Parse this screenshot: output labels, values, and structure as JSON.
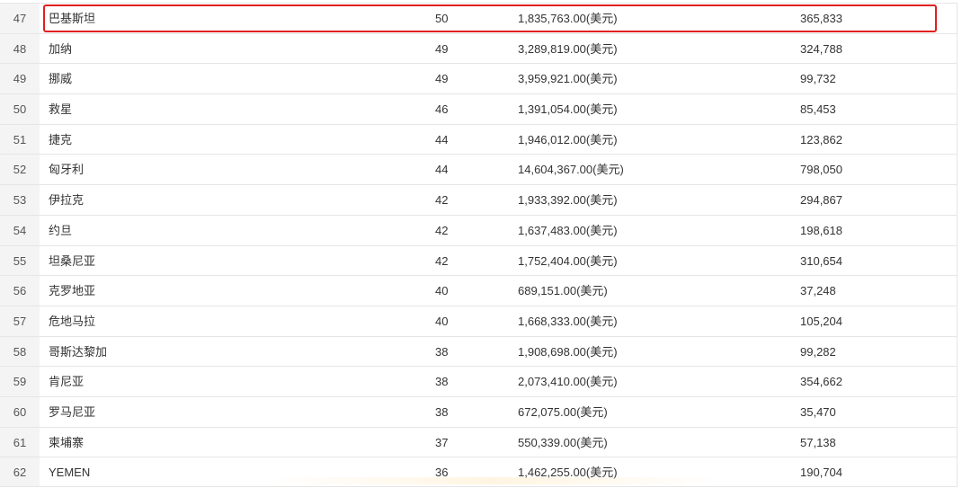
{
  "table": {
    "rows": [
      {
        "idx": "47",
        "country": "巴基斯坦",
        "count": "50",
        "amount": "1,835,763.00(美元)",
        "people": "365,833",
        "highlighted": true
      },
      {
        "idx": "48",
        "country": "加纳",
        "count": "49",
        "amount": "3,289,819.00(美元)",
        "people": "324,788"
      },
      {
        "idx": "49",
        "country": "挪威",
        "count": "49",
        "amount": "3,959,921.00(美元)",
        "people": "99,732"
      },
      {
        "idx": "50",
        "country": "救星",
        "count": "46",
        "amount": "1,391,054.00(美元)",
        "people": "85,453"
      },
      {
        "idx": "51",
        "country": "捷克",
        "count": "44",
        "amount": "1,946,012.00(美元)",
        "people": "123,862"
      },
      {
        "idx": "52",
        "country": "匈牙利",
        "count": "44",
        "amount": "14,604,367.00(美元)",
        "people": "798,050"
      },
      {
        "idx": "53",
        "country": "伊拉克",
        "count": "42",
        "amount": "1,933,392.00(美元)",
        "people": "294,867"
      },
      {
        "idx": "54",
        "country": "约旦",
        "count": "42",
        "amount": "1,637,483.00(美元)",
        "people": "198,618"
      },
      {
        "idx": "55",
        "country": "坦桑尼亚",
        "count": "42",
        "amount": "1,752,404.00(美元)",
        "people": "310,654"
      },
      {
        "idx": "56",
        "country": "克罗地亚",
        "count": "40",
        "amount": "689,151.00(美元)",
        "people": "37,248"
      },
      {
        "idx": "57",
        "country": "危地马拉",
        "count": "40",
        "amount": "1,668,333.00(美元)",
        "people": "105,204"
      },
      {
        "idx": "58",
        "country": "哥斯达黎加",
        "count": "38",
        "amount": "1,908,698.00(美元)",
        "people": "99,282"
      },
      {
        "idx": "59",
        "country": "肯尼亚",
        "count": "38",
        "amount": "2,073,410.00(美元)",
        "people": "354,662"
      },
      {
        "idx": "60",
        "country": "罗马尼亚",
        "count": "38",
        "amount": "672,075.00(美元)",
        "people": "35,470"
      },
      {
        "idx": "61",
        "country": "柬埔寨",
        "count": "37",
        "amount": "550,339.00(美元)",
        "people": "57,138"
      },
      {
        "idx": "62",
        "country": "YEMEN",
        "count": "36",
        "amount": "1,462,255.00(美元)",
        "people": "190,704"
      }
    ]
  },
  "colors": {
    "highlight_border": "#e02020",
    "index_column_bg": "#f4f4f4",
    "grid_line": "#e6e6e6",
    "text": "#333333"
  }
}
